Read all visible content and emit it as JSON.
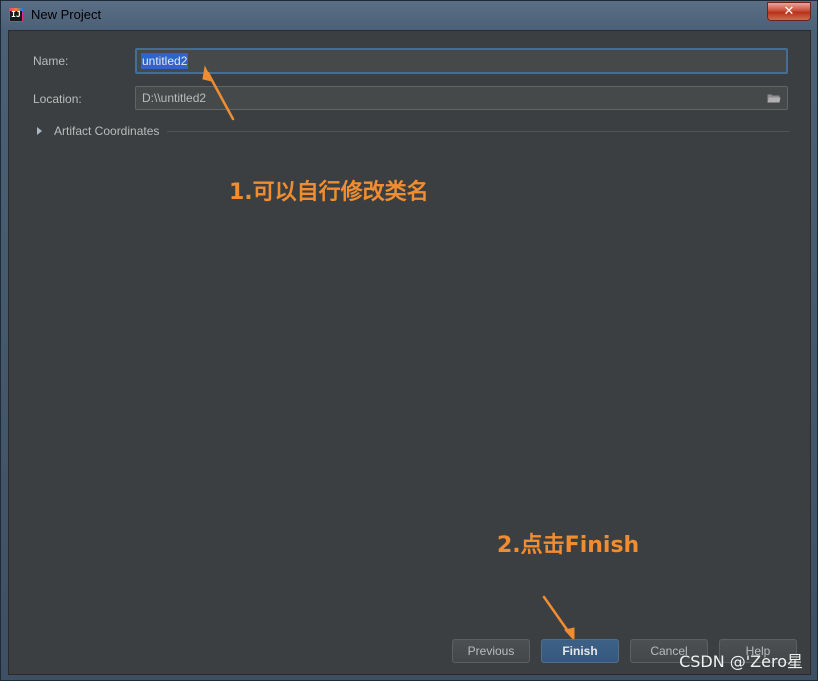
{
  "window": {
    "title": "New Project",
    "close_glyph": "✕"
  },
  "form": {
    "name_label": "Name:",
    "name_value": "untitled2",
    "location_label": "Location:",
    "location_value": "D:\\\\untitled2"
  },
  "artifact": {
    "label": "Artifact Coordinates",
    "expanded": false
  },
  "annotations": {
    "step1": "1.可以自行修改类名",
    "step2": "2.点击Finish",
    "color": "#f08d30"
  },
  "buttons": {
    "previous": "Previous",
    "finish": "Finish",
    "cancel": "Cancel",
    "help": "Help"
  },
  "watermark": "CSDN @'Zero星",
  "icons": {
    "app": "intellij-idea-icon",
    "folder": "folder-open-icon",
    "expand": "triangle-right-icon",
    "close": "close-icon"
  },
  "colors": {
    "dialog_bg": "#3c3f41",
    "selection": "#2f65ca",
    "primary_button": "#365880"
  }
}
